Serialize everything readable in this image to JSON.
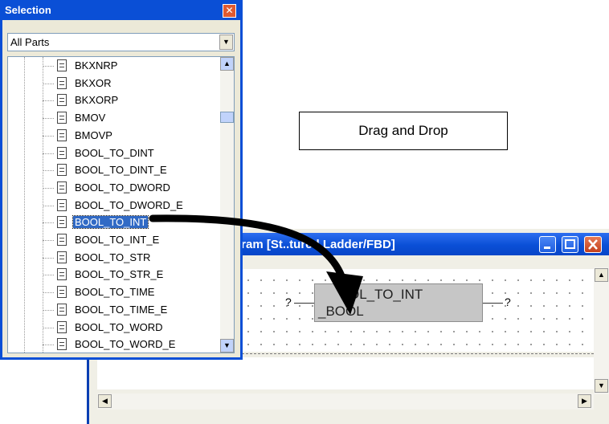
{
  "selection_panel": {
    "title": "Selection",
    "close_glyph": "✕",
    "filter_value": "All Parts",
    "items": [
      {
        "label": "BKXNRP",
        "selected": false
      },
      {
        "label": "BKXOR",
        "selected": false
      },
      {
        "label": "BKXORP",
        "selected": false
      },
      {
        "label": "BMOV",
        "selected": false
      },
      {
        "label": "BMOVP",
        "selected": false
      },
      {
        "label": "BOOL_TO_DINT",
        "selected": false
      },
      {
        "label": "BOOL_TO_DINT_E",
        "selected": false
      },
      {
        "label": "BOOL_TO_DWORD",
        "selected": false
      },
      {
        "label": "BOOL_TO_DWORD_E",
        "selected": false
      },
      {
        "label": "BOOL_TO_INT",
        "selected": true
      },
      {
        "label": "BOOL_TO_INT_E",
        "selected": false
      },
      {
        "label": "BOOL_TO_STR",
        "selected": false
      },
      {
        "label": "BOOL_TO_STR_E",
        "selected": false
      },
      {
        "label": "BOOL_TO_TIME",
        "selected": false
      },
      {
        "label": "BOOL_TO_TIME_E",
        "selected": false
      },
      {
        "label": "BOOL_TO_WORD",
        "selected": false
      },
      {
        "label": "BOOL_TO_WORD_E",
        "selected": false
      }
    ]
  },
  "annotation": {
    "drag_label": "Drag and Drop"
  },
  "ladder_window": {
    "title": "gram [St..tured Ladder/FBD]",
    "function_block": {
      "name": "OL_TO_INT",
      "port": "_BOOL"
    },
    "input_var": "?",
    "output_var": "?"
  },
  "icons": {
    "doc": "document-icon",
    "scroll_up": "▲",
    "scroll_down": "▼",
    "scroll_left": "◀",
    "scroll_right": "▶",
    "dropdown": "▼"
  },
  "colors": {
    "titlebar": "#0a4fd6",
    "selection_highlight": "#316ac5",
    "close_button": "#d9542b"
  }
}
